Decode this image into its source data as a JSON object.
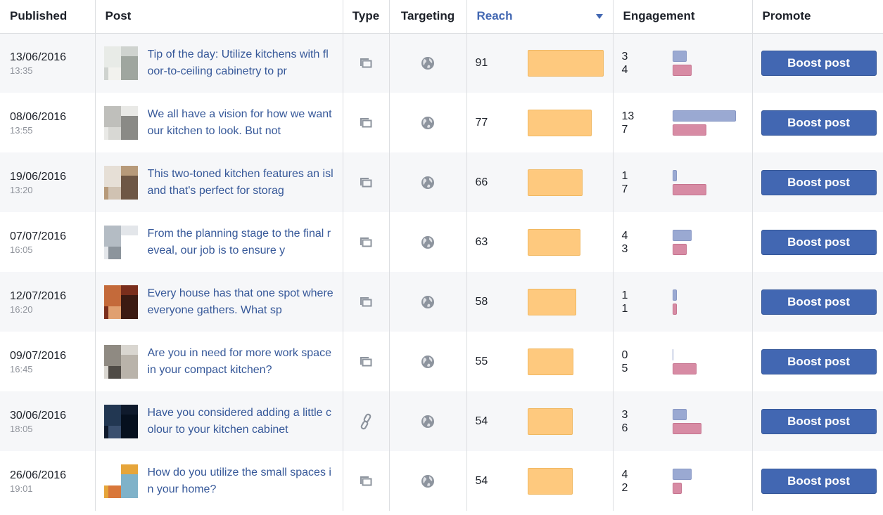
{
  "headers": {
    "published": "Published",
    "post": "Post",
    "type": "Type",
    "targeting": "Targeting",
    "reach": "Reach",
    "engagement": "Engagement",
    "promote": "Promote"
  },
  "colors": {
    "accent": "#4267b2",
    "reach_bar": "#fec97e",
    "engagement_a": "#9aa9d2",
    "engagement_b": "#d78ba4"
  },
  "max_reach": 91,
  "max_engagement": 13,
  "posts": [
    {
      "date": "13/06/2016",
      "time": "13:35",
      "text": "Tip of the day: Utilize kitchens with floor-to-ceiling cabinetry to pr",
      "type_icon": "photo-icon",
      "targeting_icon": "globe-icon",
      "reach": "91",
      "engagement_a": "3",
      "engagement_b": "4",
      "boost_label": "Boost post",
      "thumb": [
        "#cfd3cf",
        "#e8ebe7",
        "#9fa69f",
        "#f2f2ee"
      ]
    },
    {
      "date": "08/06/2016",
      "time": "13:55",
      "text": "We all have a vision for how we want our kitchen to look. But not",
      "type_icon": "photo-icon",
      "targeting_icon": "globe-icon",
      "reach": "77",
      "engagement_a": "13",
      "engagement_b": "7",
      "boost_label": "Boost post",
      "thumb": [
        "#e9e9e6",
        "#bfbfbb",
        "#8a8a86",
        "#d8d8d4"
      ]
    },
    {
      "date": "19/06/2016",
      "time": "13:20",
      "text": "This two-toned kitchen features an island that's perfect for storag",
      "type_icon": "photo-icon",
      "targeting_icon": "globe-icon",
      "reach": "66",
      "engagement_a": "1",
      "engagement_b": "7",
      "boost_label": "Boost post",
      "thumb": [
        "#b79a7a",
        "#e6dfd6",
        "#6e5745",
        "#d0c2b2"
      ]
    },
    {
      "date": "07/07/2016",
      "time": "16:05",
      "text": "From the planning stage to the final reveal, our job is to ensure y",
      "type_icon": "photo-icon",
      "targeting_icon": "globe-icon",
      "reach": "63",
      "engagement_a": "4",
      "engagement_b": "3",
      "boost_label": "Boost post",
      "thumb": [
        "#e3e6ea",
        "#b4bcc4",
        "#ffffff",
        "#8c949c"
      ]
    },
    {
      "date": "12/07/2016",
      "time": "16:20",
      "text": "Every house has that one spot where everyone gathers. What sp",
      "type_icon": "photo-icon",
      "targeting_icon": "globe-icon",
      "reach": "58",
      "engagement_a": "1",
      "engagement_b": "1",
      "boost_label": "Boost post",
      "thumb": [
        "#7a2e1c",
        "#c46a3a",
        "#3b1a12",
        "#e0a070"
      ]
    },
    {
      "date": "09/07/2016",
      "time": "16:45",
      "text": "Are you in need for more work space in your compact kitchen?",
      "type_icon": "photo-icon",
      "targeting_icon": "globe-icon",
      "reach": "55",
      "engagement_a": "0",
      "engagement_b": "5",
      "boost_label": "Boost post",
      "thumb": [
        "#d9d6d0",
        "#8f8a82",
        "#b9b3aa",
        "#4f4b46"
      ]
    },
    {
      "date": "30/06/2016",
      "time": "18:05",
      "text": "Have you considered adding a little colour to your kitchen cabinet",
      "type_icon": "link-icon",
      "targeting_icon": "globe-icon",
      "reach": "54",
      "engagement_a": "3",
      "engagement_b": "6",
      "boost_label": "Boost post",
      "thumb": [
        "#0f1a2c",
        "#223752",
        "#06101e",
        "#3a4f6e"
      ]
    },
    {
      "date": "26/06/2016",
      "time": "19:01",
      "text": "How do you utilize the small spaces in your home?",
      "type_icon": "photo-icon",
      "targeting_icon": "globe-icon",
      "reach": "54",
      "engagement_a": "4",
      "engagement_b": "2",
      "boost_label": "Boost post",
      "thumb": [
        "#e6a53a",
        "#ffffff",
        "#7fb2c9",
        "#d9773a"
      ]
    }
  ]
}
